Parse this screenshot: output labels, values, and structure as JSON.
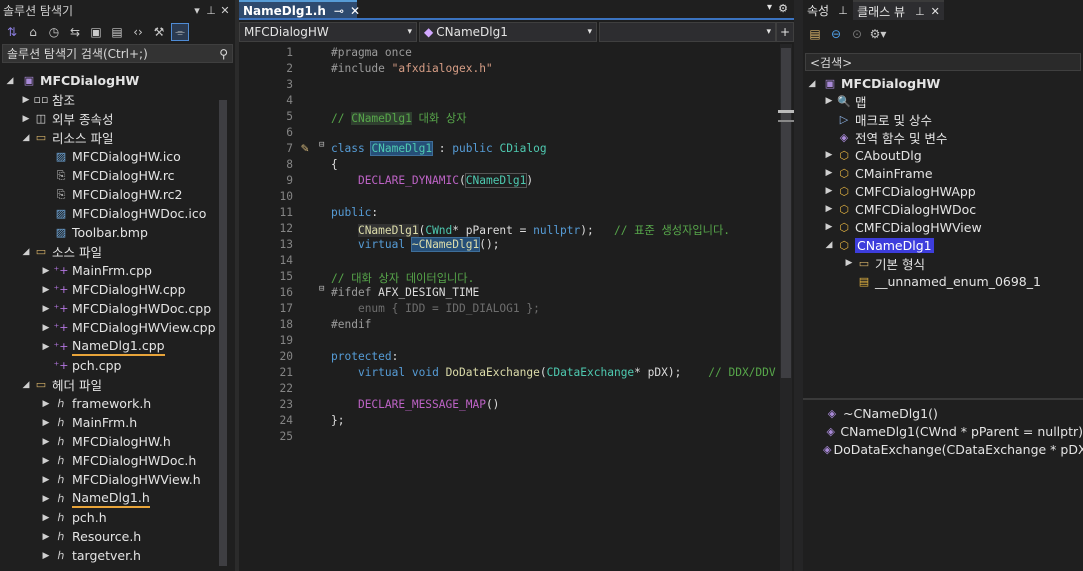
{
  "solution_explorer": {
    "title": "솔루션 탐색기",
    "search_placeholder": "솔루션 탐색기 검색(Ctrl+;)",
    "project": "MFCDialogHW",
    "items": [
      {
        "label": "참조",
        "icon": "references-icon"
      },
      {
        "label": "외부 종속성",
        "icon": "external-deps-icon"
      },
      {
        "label": "리소스 파일",
        "icon": "filter-folder-icon"
      },
      {
        "label": "MFCDialogHW.ico",
        "icon": "ico-file-icon"
      },
      {
        "label": "MFCDialogHW.rc",
        "icon": "rc-file-icon"
      },
      {
        "label": "MFCDialogHW.rc2",
        "icon": "rc-file-icon"
      },
      {
        "label": "MFCDialogHWDoc.ico",
        "icon": "ico-file-icon"
      },
      {
        "label": "Toolbar.bmp",
        "icon": "bmp-file-icon"
      },
      {
        "label": "소스 파일",
        "icon": "filter-folder-icon"
      },
      {
        "label": "MainFrm.cpp",
        "icon": "cpp-file-icon"
      },
      {
        "label": "MFCDialogHW.cpp",
        "icon": "cpp-file-icon"
      },
      {
        "label": "MFCDialogHWDoc.cpp",
        "icon": "cpp-file-icon"
      },
      {
        "label": "MFCDialogHWView.cpp",
        "icon": "cpp-file-icon"
      },
      {
        "label": "NameDlg1.cpp",
        "icon": "cpp-file-icon"
      },
      {
        "label": "pch.cpp",
        "icon": "cpp-file-icon"
      },
      {
        "label": "헤더 파일",
        "icon": "filter-folder-icon"
      },
      {
        "label": "framework.h",
        "icon": "h-file-icon"
      },
      {
        "label": "MainFrm.h",
        "icon": "h-file-icon"
      },
      {
        "label": "MFCDialogHW.h",
        "icon": "h-file-icon"
      },
      {
        "label": "MFCDialogHWDoc.h",
        "icon": "h-file-icon"
      },
      {
        "label": "MFCDialogHWView.h",
        "icon": "h-file-icon"
      },
      {
        "label": "NameDlg1.h",
        "icon": "h-file-icon"
      },
      {
        "label": "pch.h",
        "icon": "h-file-icon"
      },
      {
        "label": "Resource.h",
        "icon": "h-file-icon"
      },
      {
        "label": "targetver.h",
        "icon": "h-file-icon"
      }
    ]
  },
  "editor": {
    "tab": "NameDlg1.h",
    "scope_combo": "MFCDialogHW",
    "class_combo": "CNameDlg1",
    "member_combo": "",
    "line_numbers": [
      "1",
      "2",
      "3",
      "4",
      "5",
      "6",
      "7",
      "8",
      "9",
      "10",
      "11",
      "12",
      "13",
      "14",
      "15",
      "16",
      "17",
      "18",
      "19",
      "20",
      "21",
      "22",
      "23",
      "24",
      "25"
    ]
  },
  "right_panel": {
    "tab_properties": "속성",
    "tab_classview": "클래스 뷰",
    "search_label": "<검색>",
    "project": "MFCDialogHW",
    "items": [
      {
        "label": "맵",
        "icon": "map-icon"
      },
      {
        "label": "매크로 및 상수",
        "icon": "macro-icon"
      },
      {
        "label": "전역 함수 및 변수",
        "icon": "global-icon"
      },
      {
        "label": "CAboutDlg",
        "icon": "class-icon"
      },
      {
        "label": "CMainFrame",
        "icon": "class-icon"
      },
      {
        "label": "CMFCDialogHWApp",
        "icon": "class-icon"
      },
      {
        "label": "CMFCDialogHWDoc",
        "icon": "class-icon"
      },
      {
        "label": "CMFCDialogHWView",
        "icon": "class-icon"
      },
      {
        "label": "CNameDlg1",
        "icon": "class-icon"
      },
      {
        "label": "기본 형식",
        "icon": "folder-icon"
      },
      {
        "label": "__unnamed_enum_0698_1",
        "icon": "enum-icon"
      }
    ],
    "members": [
      "~CNameDlg1()",
      "CNameDlg1(CWnd * pParent = nullptr)",
      "DoDataExchange(CDataExchange * pDX)"
    ]
  },
  "colors": {
    "accent": "#569cd6",
    "underline": "#e8a43a",
    "selection": "#3d3ddc"
  }
}
